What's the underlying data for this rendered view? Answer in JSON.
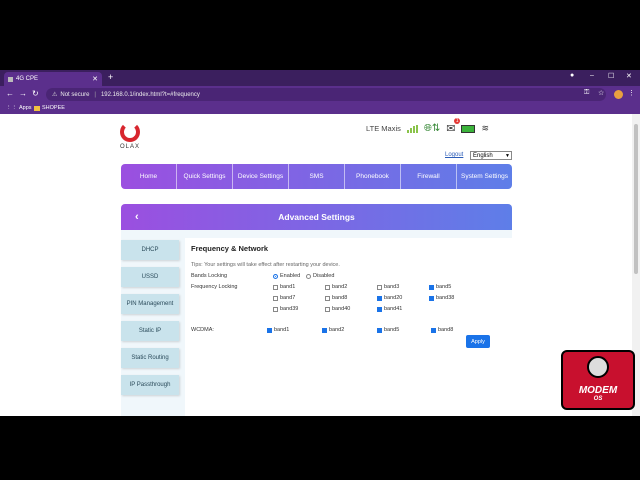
{
  "browser": {
    "tab_title": "4G CPE",
    "url_warning": "Not secure",
    "url": "192.168.0.1/index.html?t=#frequency",
    "bookmarks": [
      {
        "label": "Apps"
      },
      {
        "label": "SHOPEE"
      }
    ]
  },
  "header": {
    "brand": "OLAX",
    "network": "LTE Maxis",
    "mail_count": "1",
    "logout": "Logout",
    "language": "English"
  },
  "nav": [
    "Home",
    "Quick Settings",
    "Device Settings",
    "SMS",
    "Phonebook",
    "Firewall",
    "System Settings"
  ],
  "section_title": "Advanced Settings",
  "sidebar": [
    "DHCP",
    "USSD",
    "PIN Management",
    "Static IP",
    "Static Routing",
    "IP Passthrough"
  ],
  "panel": {
    "title": "Frequency & Network",
    "tips": "Tips: Your settings will take effect after restarting your device.",
    "bands_locking_label": "Bands Locking",
    "enabled_label": "Enabled",
    "disabled_label": "Disabled",
    "bands_locking_value": "Enabled",
    "frequency_locking_label": "Frequency Locking",
    "lte_bands": [
      {
        "label": "band1",
        "checked": false
      },
      {
        "label": "band2",
        "checked": false
      },
      {
        "label": "band3",
        "checked": false
      },
      {
        "label": "band5",
        "checked": true
      },
      {
        "label": "band7",
        "checked": false
      },
      {
        "label": "band8",
        "checked": false
      },
      {
        "label": "band20",
        "checked": true
      },
      {
        "label": "band38",
        "checked": true
      },
      {
        "label": "band39",
        "checked": false
      },
      {
        "label": "band40",
        "checked": false
      },
      {
        "label": "band41",
        "checked": true
      }
    ],
    "wcdma_label": "WCDMA:",
    "wcdma_bands": [
      {
        "label": "band1",
        "checked": true
      },
      {
        "label": "band2",
        "checked": true
      },
      {
        "label": "band5",
        "checked": true
      },
      {
        "label": "band8",
        "checked": true
      }
    ],
    "apply": "Apply"
  },
  "overlay": {
    "title": "MODEM",
    "sub": "OS"
  }
}
